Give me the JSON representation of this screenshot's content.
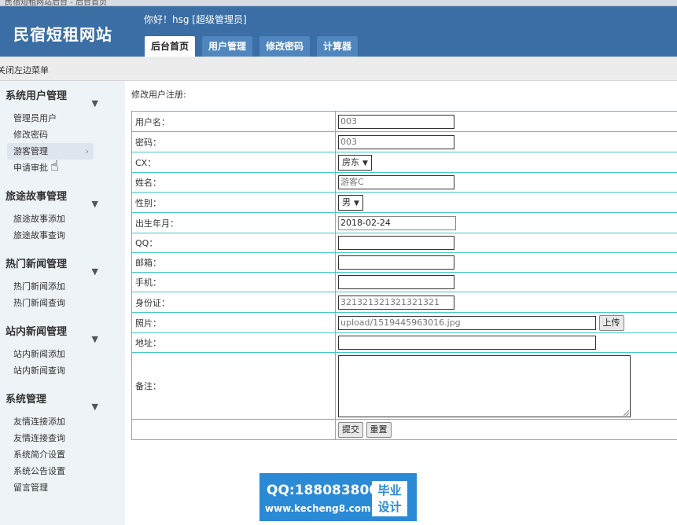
{
  "browser": {
    "tab_text": "民宿短租网站后台 - 后台首页"
  },
  "header": {
    "logo": "民宿短租网站",
    "greeting": "你好！hsg [超级管理员]",
    "tabs": [
      "后台首页",
      "用户管理",
      "修改密码",
      "计算器"
    ],
    "active_tab": 0
  },
  "toolbar": {
    "toggle_menu": "关闭左边菜单"
  },
  "sidebar": {
    "sections": [
      {
        "title": "系统用户管理",
        "items": [
          "管理员用户",
          "修改密码",
          "游客管理",
          "申请审批"
        ]
      },
      {
        "title": "旅途故事管理",
        "items": [
          "旅途故事添加",
          "旅途故事查询"
        ]
      },
      {
        "title": "热门新闻管理",
        "items": [
          "热门新闻添加",
          "热门新闻查询"
        ]
      },
      {
        "title": "站内新闻管理",
        "items": [
          "站内新闻添加",
          "站内新闻查询"
        ]
      },
      {
        "title": "系统管理",
        "items": [
          "友情连接添加",
          "友情连接查询",
          "系统简介设置",
          "系统公告设置",
          "留言管理"
        ]
      }
    ],
    "hovered_item": "游客管理"
  },
  "form": {
    "title": "修改用户注册:",
    "username_label": "用户名：",
    "username_value": "003",
    "password_label": "密码：",
    "password_value": "003",
    "cx_label": "CX：",
    "cx_value": "房东",
    "name_label": "姓名：",
    "name_value": "游客C",
    "gender_label": "性别：",
    "gender_value": "男",
    "birth_label": "出生年月：",
    "birth_value": "2018-02-24",
    "qq_label": "QQ：",
    "qq_value": "",
    "email_label": "邮箱：",
    "email_value": "",
    "phone_label": "手机：",
    "phone_value": "",
    "idcard_label": "身份证：",
    "idcard_value": "321321321321321321",
    "photo_label": "照片：",
    "photo_value": "upload/1519445963016.jpg",
    "upload_button": "上传",
    "address_label": "地址：",
    "address_value": "",
    "remark_label": "备注：",
    "remark_value": "",
    "submit_button": "提交",
    "reset_button": "重置"
  },
  "watermark": {
    "qq": "QQ:188083800",
    "url": "www.kecheng8.com",
    "badge_line1": "毕业",
    "badge_line2": "设计"
  }
}
